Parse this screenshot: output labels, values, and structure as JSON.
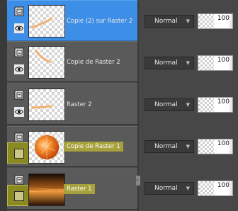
{
  "layers": [
    {
      "name": "Copie (2) sur Raster 2",
      "blend_mode": "Normal",
      "opacity": "100",
      "selected": true,
      "thumb": "brush-stroke"
    },
    {
      "name": "Copie de Raster 2",
      "blend_mode": "Normal",
      "opacity": "100",
      "selected": false,
      "thumb": "brush-stroke"
    },
    {
      "name": "Raster 2",
      "blend_mode": "Normal",
      "opacity": "100",
      "selected": false,
      "thumb": "brush-stroke"
    },
    {
      "name": "Copie de Raster 1",
      "blend_mode": "Normal",
      "opacity": "100",
      "selected": false,
      "thumb": "orange-ball",
      "has_mask": true
    },
    {
      "name": "Raster 1",
      "blend_mode": "Normal",
      "opacity": "100",
      "selected": false,
      "thumb": "orange-texture",
      "has_mask": true
    }
  ],
  "colors": {
    "selected_row": "#3d8ee6",
    "highlight_label": "#a6a13c",
    "row": "#5a5a5a"
  }
}
